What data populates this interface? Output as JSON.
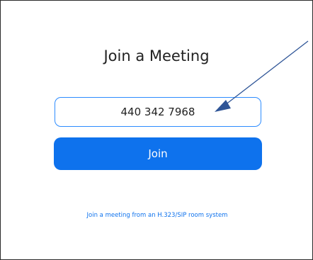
{
  "dialog": {
    "title": "Join a Meeting",
    "meeting_id_value": "440 342 7968",
    "join_label": "Join",
    "h323_link_text": "Join a meeting from an H.323/SIP room system"
  },
  "colors": {
    "accent": "#0e72ed",
    "input_border": "#2d8cff",
    "annotation_arrow": "#2f5597"
  },
  "icons": {
    "annotation": "arrow-pointer-icon"
  }
}
